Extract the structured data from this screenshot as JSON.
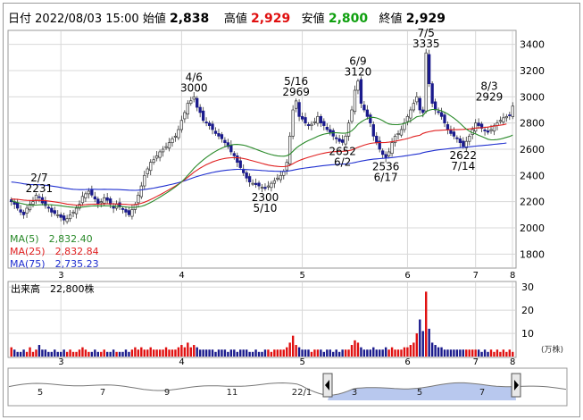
{
  "header": {
    "date_label": "日付",
    "date": "2022/08/03 15:00",
    "open_label": "始値",
    "open": "2,838",
    "high_label": "高値",
    "high": "2,929",
    "low_label": "安値",
    "low": "2,800",
    "close_label": "終値",
    "close": "2,929"
  },
  "legend": {
    "ma5": "MA(5)　2,832.40",
    "ma25": "MA(25)　2,832.84",
    "ma75": "MA(75)　2,735.23"
  },
  "volume_header": "出来高　22,800株",
  "volume_unit": "(万株)",
  "colors": {
    "up": "#e01010",
    "down": "#1a1a8c",
    "ma5": "#2a8a2a",
    "ma25": "#e02020",
    "ma75": "#2030d0",
    "grid": "#d8d8d8"
  },
  "chart_data": [
    {
      "type": "candlestick",
      "ylim": [
        1700,
        3500
      ],
      "yticks": [
        1800,
        2000,
        2200,
        2400,
        2600,
        2800,
        3000,
        3200,
        3400
      ],
      "xticks": [
        "3",
        "4",
        "5",
        "6",
        "7",
        "8"
      ],
      "annotations": [
        {
          "date": "2/7",
          "value": 2231,
          "labels": [
            "2/7",
            "2231"
          ]
        },
        {
          "date": "4/6",
          "value": 3000,
          "labels": [
            "4/6",
            "3000"
          ]
        },
        {
          "date": "5/10",
          "value": 2300,
          "labels": [
            "2300",
            "5/10"
          ]
        },
        {
          "date": "5/16",
          "value": 2969,
          "labels": [
            "5/16",
            "2969"
          ]
        },
        {
          "date": "6/2",
          "value": 2652,
          "labels": [
            "2652",
            "6/2"
          ]
        },
        {
          "date": "6/9",
          "value": 3120,
          "labels": [
            "6/9",
            "3120"
          ]
        },
        {
          "date": "6/17",
          "value": 2536,
          "labels": [
            "2536",
            "6/17"
          ]
        },
        {
          "date": "7/5",
          "value": 3335,
          "labels": [
            "7/5",
            "3335"
          ]
        },
        {
          "date": "7/14",
          "value": 2622,
          "labels": [
            "2622",
            "7/14"
          ]
        },
        {
          "date": "8/3",
          "value": 2929,
          "labels": [
            "8/3",
            "2929"
          ]
        }
      ],
      "close": [
        2200,
        2180,
        2150,
        2120,
        2100,
        2150,
        2180,
        2200,
        2250,
        2231,
        2190,
        2170,
        2150,
        2120,
        2110,
        2100,
        2080,
        2060,
        2070,
        2100,
        2120,
        2150,
        2180,
        2240,
        2260,
        2280,
        2250,
        2220,
        2180,
        2200,
        2230,
        2210,
        2180,
        2150,
        2180,
        2160,
        2140,
        2120,
        2100,
        2140,
        2180,
        2250,
        2320,
        2400,
        2450,
        2500,
        2520,
        2550,
        2580,
        2600,
        2620,
        2650,
        2680,
        2700,
        2750,
        2820,
        2880,
        2950,
        2970,
        3000,
        2920,
        2880,
        2820,
        2800,
        2780,
        2750,
        2720,
        2700,
        2680,
        2650,
        2620,
        2580,
        2550,
        2500,
        2460,
        2420,
        2380,
        2350,
        2340,
        2330,
        2320,
        2310,
        2300,
        2320,
        2340,
        2360,
        2380,
        2400,
        2430,
        2500,
        2700,
        2900,
        2969,
        2850,
        2830,
        2800,
        2780,
        2790,
        2810,
        2850,
        2800,
        2780,
        2750,
        2730,
        2700,
        2680,
        2660,
        2652,
        2700,
        2800,
        2900,
        3050,
        3120,
        2950,
        2900,
        2850,
        2800,
        2700,
        2650,
        2600,
        2560,
        2536,
        2580,
        2650,
        2700,
        2720,
        2750,
        2800,
        2850,
        2900,
        2950,
        3000,
        2900,
        2880,
        3335,
        3100,
        2950,
        2900,
        2880,
        2850,
        2800,
        2750,
        2720,
        2700,
        2680,
        2650,
        2622,
        2660,
        2700,
        2750,
        2800,
        2780,
        2760,
        2740,
        2730,
        2750,
        2780,
        2800,
        2820,
        2840,
        2850,
        2860,
        2929
      ],
      "ma5": [
        2208.4,
        2199.4,
        2193.5,
        2187.2,
        2182.0,
        2177.4,
        2174.4,
        2173.3,
        2174.0,
        2176.1,
        2176.8,
        2177.2,
        2177.0,
        2175.7,
        2173.9,
        2171.5,
        2168.5,
        2165.0,
        2161.6,
        2159.2,
        2157.4,
        2156.6,
        2156.5,
        2158.7,
        2161.6,
        2165.0,
        2167.2,
        2168.1,
        2167.4,
        2167.4,
        2168.2,
        2168.5,
        2167.7,
        2166.0,
        2165.3,
        2164.1,
        2162.3,
        2159.9,
        2157.1,
        2156.2,
        2156.6,
        2159.8,
        2164.6,
        2172.1,
        2181.9,
        2193.8,
        2206.6,
        2220.3,
        2234.6,
        2249.3,
        2264.2,
        2279.7,
        2295.9,
        2312.5,
        2330.6,
        2351.2,
        2374.4,
        2400.4,
        2426.8,
        2453.9,
        2477.5,
        2499.2,
        2518.8,
        2537.3,
        2554.5,
        2570.3,
        2584.4,
        2597.2,
        2608.6,
        2618.4,
        2626.3,
        2632.1,
        2635.8,
        2636.7,
        2635.0,
        2631.1,
        2624.9,
        2617.1,
        2608.8,
        2600.1,
        2591.3,
        2582.3,
        2573.3,
        2565.6,
        2559.1,
        2553.9,
        2549.8,
        2547.2,
        2546.5,
        2550.3,
        2562.7,
        2584.8,
        2608.1,
        2625.8,
        2641.2,
        2654.4,
        2665.9,
        2676.4,
        2686.9,
        2698.8,
        2707.7,
        2714.9,
        2720.1,
        2723.7,
        2725.4,
        2725.4,
        2724.0,
        2722.3,
        2722.7,
        2728.0,
        2740.8,
        2762.8,
        2790.7,
        2808.0,
        2822.8,
        2834.6,
        2842.8,
        2843.1,
        2838.8,
        2830.6,
        2818.1,
        2804.0,
        2792.9,
        2788.9,
        2787.8,
        2788.4,
        2790.9,
        2796.8,
        2805.5,
        2816.9,
        2831.1,
        2847.5,
        2852.5,
        2856.6,
        2885.5,
        2897.7,
        2903.4,
        2903.1,
        2899.6,
        2893.4,
        2882.4,
        2869.2,
        2853.9,
        2837.4,
        2818.9,
        2797.6,
        2774.3,
        2754.2,
        2737.9,
        2725.4,
        2717.2,
        2706.7,
        2697.4,
        2686.7,
        2676.6,
        2671.8,
        2672.1,
        2673.5,
        2677.7,
        2683.7,
        2691.0,
        2697.6,
        2708.5
      ],
      "ma25": [
        2220.0,
        2219.1,
        2217.5,
        2215.1,
        2212.2,
        2210.3,
        2209.0,
        2208.4,
        2209.5,
        2210.0,
        2209.0,
        2207.4,
        2205.1,
        2201.9,
        2198.6,
        2195.0,
        2190.7,
        2185.8,
        2181.5,
        2178.3,
        2175.6,
        2173.8,
        2172.8,
        2174.3,
        2176.5,
        2179.3,
        2180.9,
        2181.7,
        2181.6,
        2182.2,
        2183.3,
        2183.8,
        2183.6,
        2182.6,
        2182.4,
        2181.8,
        2180.7,
        2179.2,
        2177.1,
        2176.8,
        2177.7,
        2181.8,
        2187.8,
        2195.8,
        2205.3,
        2216.1,
        2227.7,
        2239.9,
        2252.6,
        2265.5,
        2278.4,
        2291.7,
        2305.3,
        2319.2,
        2333.9,
        2349.9,
        2367.3,
        2386.2,
        2405.3,
        2424.7,
        2440.6,
        2455.8,
        2469.3,
        2481.9,
        2493.1,
        2502.9,
        2511.4,
        2518.7,
        2524.8,
        2529.6,
        2533.1,
        2535.3,
        2536.1,
        2535.3,
        2533.0,
        2529.2,
        2524.0,
        2517.8,
        2511.3,
        2504.7,
        2498.1,
        2491.7,
        2485.2,
        2479.6,
        2475.0,
        2471.5,
        2468.9,
        2467.1,
        2466.8,
        2469.6,
        2477.2,
        2490.1,
        2503.5,
        2513.9,
        2523.2,
        2531.3,
        2538.7,
        2545.5,
        2552.4,
        2559.4,
        2565.4,
        2570.3,
        2574.6,
        2578.1,
        2580.7,
        2582.6,
        2583.7,
        2584.5,
        2586.0,
        2589.1,
        2594.8,
        2603.8,
        2614.7,
        2623.2,
        2631.2,
        2638.2,
        2644.3,
        2647.8,
        2649.6,
        2650.2,
        2650.6,
        2651.9,
        2654.1,
        2657.6,
        2661.7,
        2666.0,
        2670.8,
        2676.0,
        2682.1,
        2688.9,
        2696.5,
        2701.5,
        2706.6,
        2720.8,
        2728.1,
        2733.8,
        2738.7,
        2742.3,
        2744.1,
        2745.2,
        2746.9,
        2748.0,
        2748.8,
        2749.4,
        2749.5,
        2750.6,
        2751.7,
        2752.9,
        2755.1,
        2758.5,
        2761.9,
        2762.7,
        2763.3,
        2766.1,
        2769.3,
        2773.0,
        2776.9,
        2780.2,
        2783.5,
        2786.7,
        2792.9
      ],
      "ma75": [
        2350.0,
        2347.6,
        2344.4,
        2340.6,
        2336.3,
        2333.4,
        2331.3,
        2329.8,
        2329.7,
        2329.1,
        2327.4,
        2325.2,
        2322.6,
        2319.3,
        2315.9,
        2312.4,
        2308.5,
        2304.4,
        2300.6,
        2297.5,
        2294.8,
        2292.9,
        2291.6,
        2291.9,
        2292.7,
        2293.9,
        2294.5,
        2294.6,
        2294.2,
        2294.1,
        2294.3,
        2294.2,
        2293.7,
        2292.8,
        2292.3,
        2291.5,
        2290.5,
        2289.2,
        2287.6,
        2286.8,
        2286.6,
        2287.7,
        2289.6,
        2292.3,
        2295.6,
        2299.4,
        2303.6,
        2308.1,
        2312.8,
        2317.7,
        2322.7,
        2328.0,
        2333.4,
        2339.1,
        2345.2,
        2351.9,
        2359.3,
        2367.4,
        2375.7,
        2384.4,
        2391.9,
        2399.0,
        2405.5,
        2411.7,
        2417.4,
        2422.6,
        2427.3,
        2431.5,
        2435.3,
        2438.5,
        2441.3,
        2443.5,
        2445.1,
        2446.3,
        2446.5,
        2446.2,
        2445.4,
        2444.2,
        2442.8,
        2441.2,
        2439.6,
        2437.9,
        2436.1,
        2434.6,
        2433.4,
        2432.4,
        2431.6,
        2431.1,
        2431.3,
        2432.6,
        2435.6,
        2440.2,
        2445.3,
        2449.3,
        2453.1,
        2456.5,
        2459.7,
        2462.8,
        2466.0,
        2469.3,
        2472.4,
        2475.1,
        2477.8,
        2480.1,
        2482.1,
        2483.9,
        2485.4,
        2486.7,
        2488.2,
        2490.6,
        2494.0,
        2498.8,
        2504.4,
        2509.1,
        2513.5,
        2517.6,
        2521.2,
        2524.1,
        2526.6,
        2528.6,
        2530.3,
        2532.1,
        2534.2,
        2536.7,
        2539.3,
        2542.0,
        2545.0,
        2548.2,
        2551.7,
        2555.6,
        2559.8,
        2563.3,
        2566.8,
        2574.1,
        2579.1,
        2583.6,
        2587.8,
        2591.6,
        2595.0,
        2598.0,
        2600.9,
        2603.6,
        2606.0,
        2608.1,
        2610.0,
        2612.0,
        2614.1,
        2616.2,
        2618.7,
        2621.4,
        2623.8,
        2625.9,
        2627.9,
        2630.0,
        2632.3,
        2634.7,
        2637.2,
        2639.6,
        2642.0,
        2644.4,
        2647.6
      ],
      "legend_position": "bottom-left"
    },
    {
      "type": "bar",
      "name": "volume",
      "ylim": [
        0,
        32
      ],
      "yticks": [
        10,
        20,
        30
      ],
      "values": [
        4,
        3,
        2,
        2,
        3,
        2,
        4,
        2,
        3,
        5,
        3,
        3,
        2,
        2,
        3,
        2,
        2,
        3,
        2,
        3,
        2,
        2,
        3,
        4,
        3,
        2,
        2,
        3,
        2,
        2,
        3,
        2,
        2,
        3,
        2,
        2,
        2,
        3,
        2,
        3,
        4,
        3,
        4,
        3,
        3,
        4,
        3,
        3,
        3,
        3,
        4,
        3,
        3,
        3,
        4,
        5,
        4,
        6,
        4,
        5,
        4,
        3,
        3,
        3,
        3,
        3,
        2,
        3,
        3,
        3,
        2,
        3,
        3,
        2,
        3,
        3,
        3,
        2,
        2,
        3,
        2,
        2,
        3,
        3,
        2,
        3,
        3,
        3,
        3,
        4,
        6,
        9,
        5,
        4,
        3,
        3,
        3,
        2,
        3,
        3,
        3,
        2,
        3,
        3,
        2,
        3,
        2,
        3,
        3,
        3,
        5,
        7,
        6,
        4,
        3,
        3,
        3,
        4,
        3,
        3,
        3,
        4,
        3,
        4,
        3,
        3,
        3,
        4,
        4,
        5,
        6,
        10,
        16,
        11,
        28,
        12,
        6,
        5,
        4,
        4,
        3,
        3,
        3,
        3,
        3,
        3,
        3,
        3,
        3,
        3,
        3,
        3,
        2,
        3,
        2,
        3,
        2,
        3,
        2,
        3,
        2,
        3,
        2
      ]
    }
  ],
  "navigator": {
    "labels": [
      "5",
      "7",
      "9",
      "11",
      "22/1",
      "3",
      "5",
      "7"
    ]
  }
}
